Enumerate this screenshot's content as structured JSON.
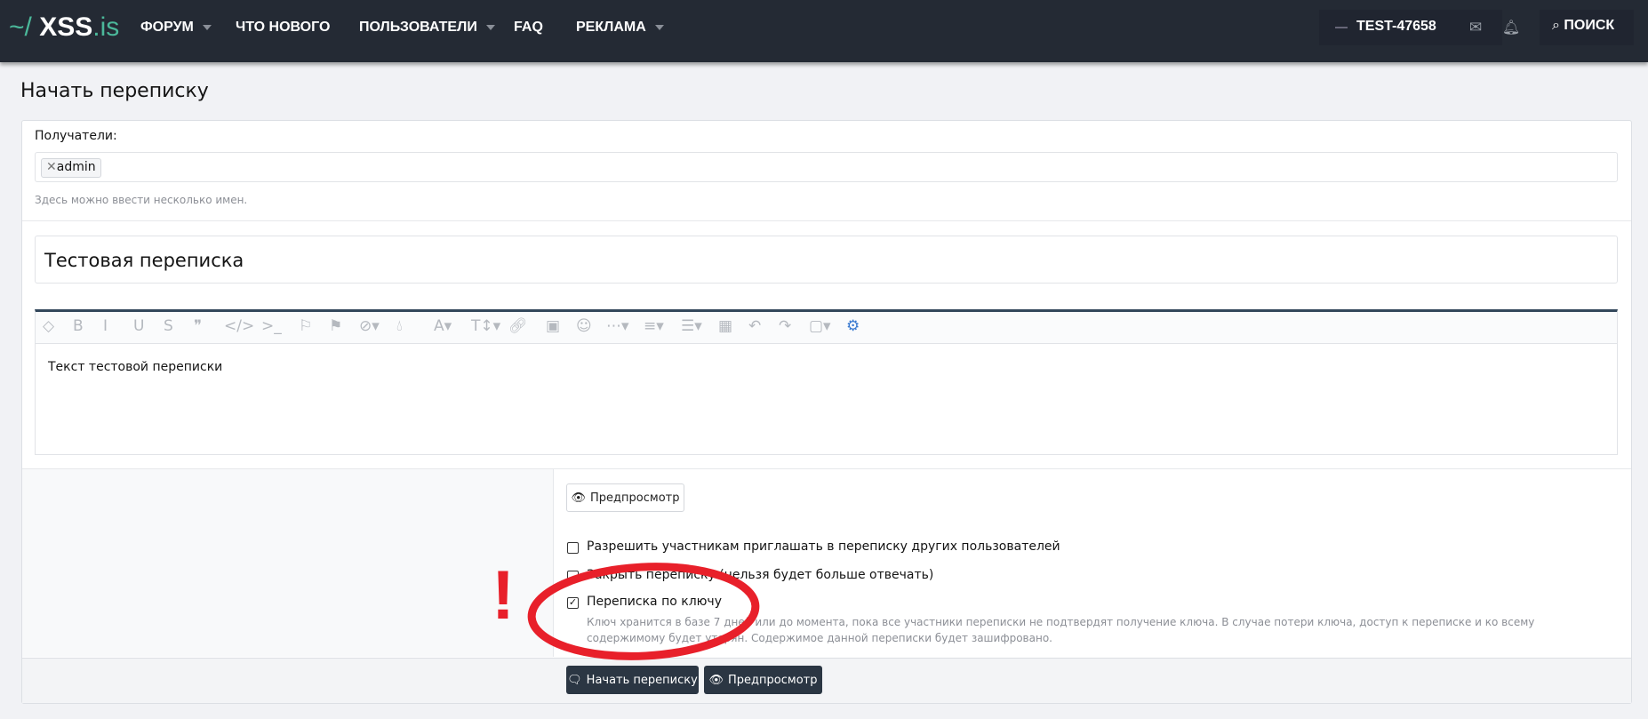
{
  "header": {
    "logo_prefix": "~/",
    "logo_main": "XSS",
    "logo_suffix": ".is",
    "nav": [
      {
        "label": "ФОРУМ",
        "dropdown": true
      },
      {
        "label": "ЧТО НОВОГО",
        "dropdown": false
      },
      {
        "label": "ПОЛЬЗОВАТЕЛИ",
        "dropdown": true
      },
      {
        "label": "FAQ",
        "dropdown": false
      },
      {
        "label": "РЕКЛАМА",
        "dropdown": true
      }
    ],
    "username": "TEST-47658",
    "search_label": "ПОИСК"
  },
  "page": {
    "title": "Начать переписку"
  },
  "form": {
    "recipients_label": "Получатели:",
    "recipients": [
      "admin"
    ],
    "recipients_hint": "Здесь можно ввести несколько имен.",
    "subject_value": "Тестовая переписка",
    "toolbar_icons": [
      "eraser-icon",
      "bold-icon",
      "italic-icon",
      "underline-icon",
      "strike-icon",
      "quote-icon",
      "code-icon",
      "inline-code-icon",
      "spoiler-icon",
      "flag-icon",
      "hide-icon",
      "color-icon",
      "font-icon",
      "text-size-icon",
      "link-icon",
      "image-icon",
      "smilie-icon",
      "more-icon",
      "align-icon",
      "list-icon",
      "table-icon",
      "undo-icon",
      "redo-icon",
      "drafts-icon",
      "settings-icon"
    ],
    "body_value": "Текст тестовой переписки",
    "preview_label": "Предпросмотр",
    "options": [
      {
        "label": "Разрешить участникам приглашать в переписку других пользователей",
        "checked": false
      },
      {
        "label": "Закрыть переписку (нельзя будет больше отвечать)",
        "checked": false
      },
      {
        "label": "Переписка по ключу",
        "checked": true
      }
    ],
    "key_hint": "Ключ хранится в базе 7 дней или до момента, пока все участники переписки не подтвердят получение ключа. В случае потери ключа, доступ к переписке и ко всему содержимому будет утерян. Содержимое данной переписки будет зашифровано.",
    "submit_label": "Начать переписку",
    "submit_preview_label": "Предпросмотр"
  },
  "annotation": {
    "mark": "!",
    "color": "#e8202a"
  },
  "colors": {
    "header_bg": "#242a34",
    "accent": "#4bb89a",
    "button_dark": "#2b3643"
  }
}
